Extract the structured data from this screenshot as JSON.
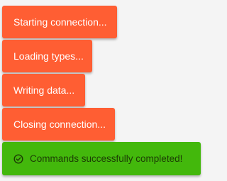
{
  "toasts": [
    {
      "text": "Starting connection..."
    },
    {
      "text": "Loading types..."
    },
    {
      "text": "Writing data..."
    },
    {
      "text": "Closing connection..."
    }
  ],
  "success": {
    "text": "Commands successfully completed!",
    "icon": "check-circle-icon"
  },
  "colors": {
    "info_toast": "#ff5e33",
    "success_toast": "#43b80c",
    "background": "#f4f4f4"
  }
}
